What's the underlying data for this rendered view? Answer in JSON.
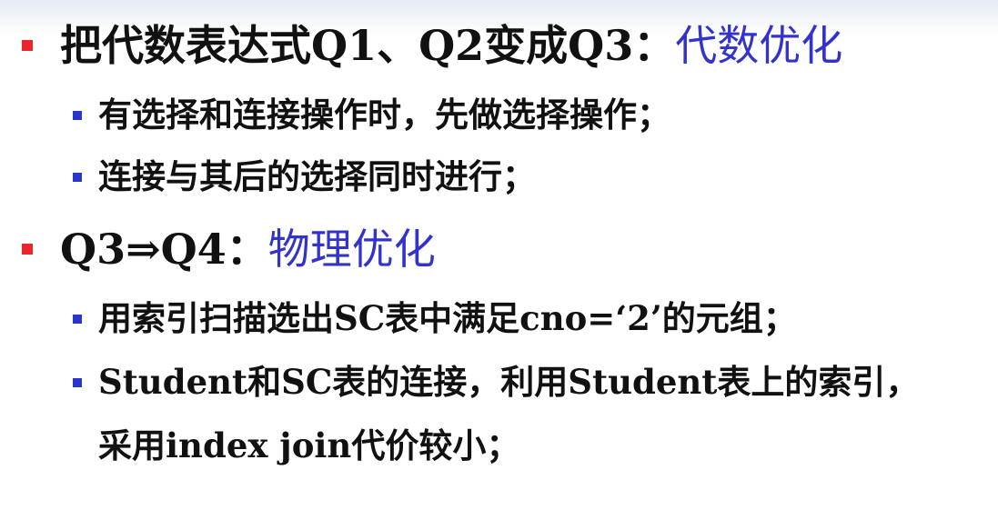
{
  "bullets": {
    "level1_color": "#e8262c",
    "level2_color": "#2a36c8"
  },
  "items": [
    {
      "text": "把代数表达式Q1、Q2变成Q3：",
      "highlight": "代数优化",
      "highlight_color": "#3333cc"
    },
    {
      "text": "有选择和连接操作时，先做选择操作；"
    },
    {
      "text": "连接与其后的选择同时进行；"
    },
    {
      "text": "Q3⇒Q4：",
      "highlight": "物理优化",
      "highlight_color": "#3333cc"
    },
    {
      "text": "用索引扫描选出SC表中满足cno=‘2’的元组；"
    },
    {
      "text": "Student和SC表的连接，利用Student表上的索引，"
    },
    {
      "text": "采用index join代价较小；"
    }
  ]
}
